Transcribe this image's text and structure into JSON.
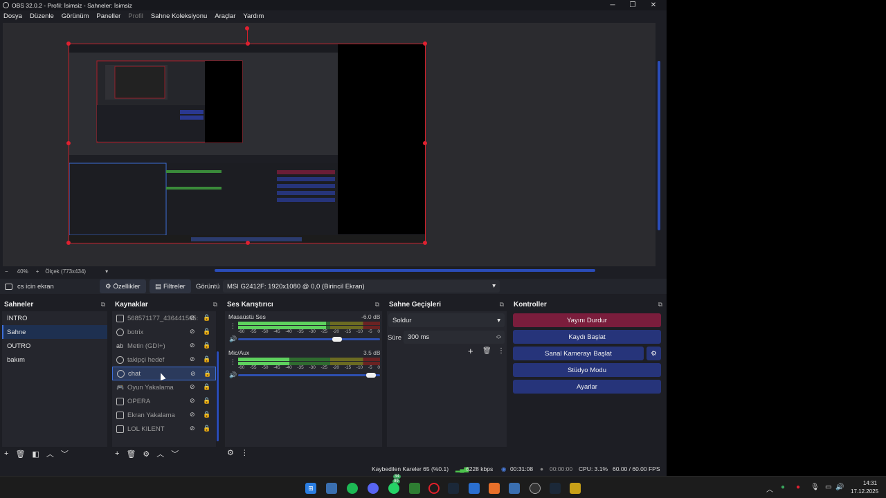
{
  "window": {
    "title": "OBS 32.0.2 - Profil: İsimsiz - Sahneler: İsimsiz",
    "minimize": "─",
    "maximize": "❐",
    "close": "✕"
  },
  "menu": [
    "Dosya",
    "Düzenle",
    "Görünüm",
    "Paneller",
    "Profil",
    "Sahne Koleksiyonu",
    "Araçlar",
    "Yardım"
  ],
  "zoom": {
    "minus": "−",
    "value": "40%",
    "plus": "+",
    "scale_label": "Ölçek (773x434)"
  },
  "source_toolbar": {
    "selected_source": "cs icin ekran",
    "properties": "Özellikler",
    "filters": "Filtreler",
    "display_label": "Görüntü",
    "display_value": "MSI G2412F: 1920x1080 @ 0,0 (Birincil Ekran)"
  },
  "scenes": {
    "title": "Sahneler",
    "items": [
      "İNTRO",
      "Sahne",
      "OUTRO",
      "bakım"
    ],
    "selected_index": 1
  },
  "sources": {
    "title": "Kaynaklar",
    "items": [
      {
        "name": "568571177_436441565:",
        "icon": "image-icon"
      },
      {
        "name": "botrix",
        "icon": "browser-icon"
      },
      {
        "name": "Metin (GDI+)",
        "icon": "text-icon"
      },
      {
        "name": "takipçi hedef",
        "icon": "browser-icon"
      },
      {
        "name": "chat",
        "icon": "browser-icon"
      },
      {
        "name": "Oyun Yakalama",
        "icon": "gamepad-icon"
      },
      {
        "name": "OPERA",
        "icon": "window-icon"
      },
      {
        "name": "Ekran Yakalama",
        "icon": "monitor-icon"
      },
      {
        "name": "LOL KILENT",
        "icon": "window-icon"
      }
    ],
    "selected_index": 4
  },
  "mixer": {
    "title": "Ses Karıştırıcı",
    "channels": [
      {
        "name": "Masaüstü Ses",
        "db": "-6.0 dB",
        "level": 0.62,
        "volume": 0.73
      },
      {
        "name": "Mic/Aux",
        "db": "3.5 dB",
        "level": 0.36,
        "volume": 0.97
      }
    ],
    "scale": [
      "-60",
      "-55",
      "-50",
      "-45",
      "-40",
      "-35",
      "-30",
      "-25",
      "-20",
      "-15",
      "-10",
      "-5",
      "0"
    ]
  },
  "transitions": {
    "title": "Sahne Geçişleri",
    "type": "Soldur",
    "duration_label": "Süre",
    "duration_value": "300 ms"
  },
  "controls": {
    "title": "Kontroller",
    "buttons": [
      "Yayını Durdur",
      "Kaydı Başlat",
      "Sanal Kamerayı Başlat",
      "Stüdyo Modu",
      "Ayarlar"
    ]
  },
  "status": {
    "dropped": "Kaybedilen Kareler 65 (%0.1)",
    "bitrate": "6228 kbps",
    "stream_time": "00:31:08",
    "rec_time": "00:00:00",
    "cpu": "CPU: 3.1%",
    "fps": "60.00 / 60.00 FPS"
  },
  "taskbar": {
    "time": "14:31",
    "date": "17.12.2025",
    "badge_discord": "99",
    "badge_whatsapp": "34"
  },
  "colors": {
    "accent": "#3d6fd8",
    "stop_button": "#7a1d3c",
    "control_button": "#26347a",
    "selection_border": "#d1202a"
  }
}
